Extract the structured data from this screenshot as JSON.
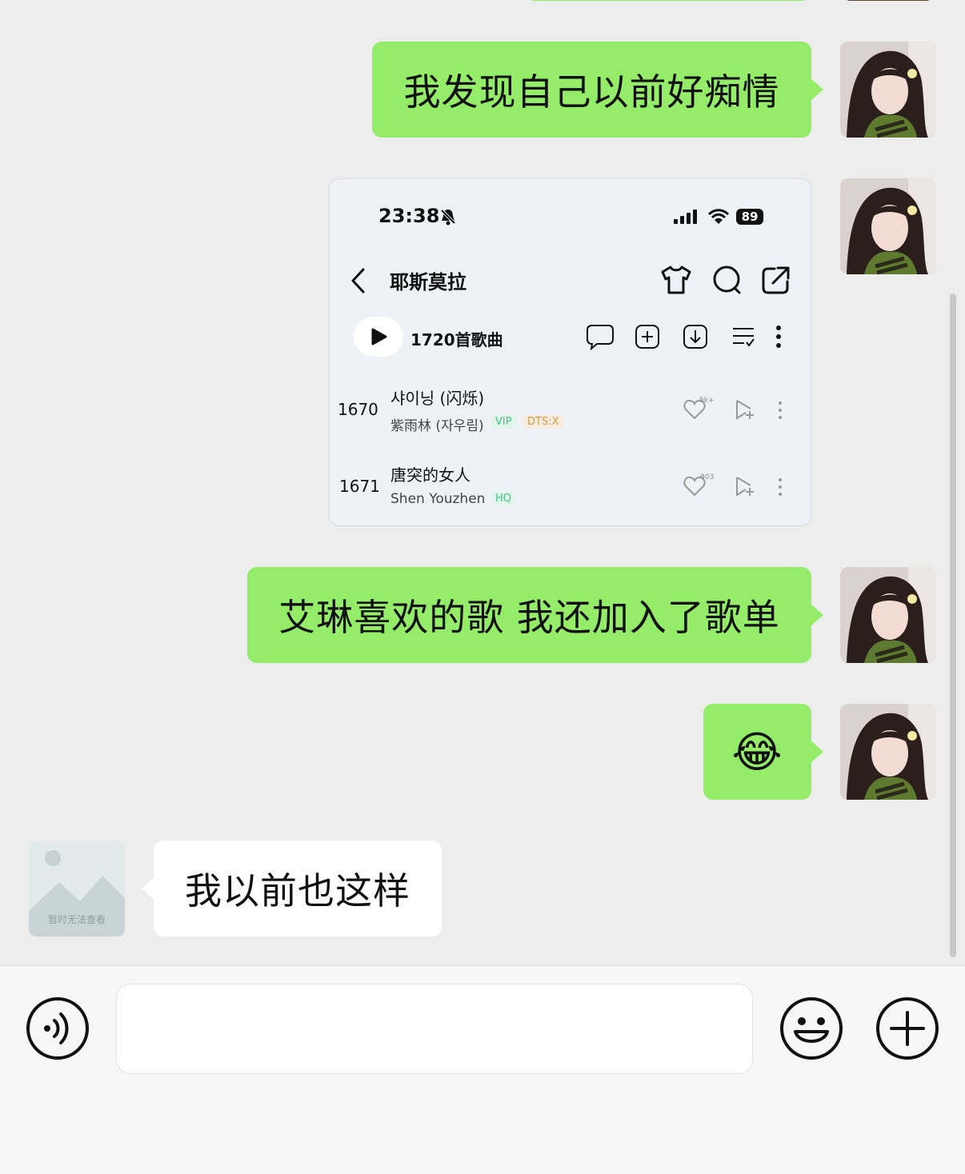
{
  "messages": [
    {
      "side": "right",
      "type": "text",
      "text": "我发现自己以前好痴情"
    },
    {
      "side": "right",
      "type": "screenshot"
    },
    {
      "side": "right",
      "type": "text",
      "text": "艾琳喜欢的歌 我还加入了歌单"
    },
    {
      "side": "right",
      "type": "emoji",
      "text": "😂"
    },
    {
      "side": "left",
      "type": "text",
      "text": "我以前也这样"
    }
  ],
  "screenshot": {
    "status_time": "23:38",
    "battery": "89",
    "playlist_title": "耶斯莫拉",
    "song_count": "1720首歌曲",
    "songs": [
      {
        "index": "1670",
        "title": "샤이닝 (闪烁)",
        "artist": "紫雨林 (자우림)",
        "tags": [
          "VIP",
          "DTS:X"
        ],
        "likes": "5k+"
      },
      {
        "index": "1671",
        "title": "唐突的女人",
        "artist": "Shen Youzhen",
        "tags": [
          "HQ"
        ],
        "likes": "803"
      }
    ]
  },
  "left_avatar_caption": "暂时无法查看",
  "colors": {
    "chat_bg": "#ededed",
    "sent_bubble": "#95ec69",
    "received_bubble": "#ffffff",
    "input_bar_bg": "#f7f7f7"
  },
  "input_bar": {
    "left_icon": "voice-icon",
    "right_icons": [
      "emoji-face-icon",
      "plus-circle-icon"
    ]
  }
}
